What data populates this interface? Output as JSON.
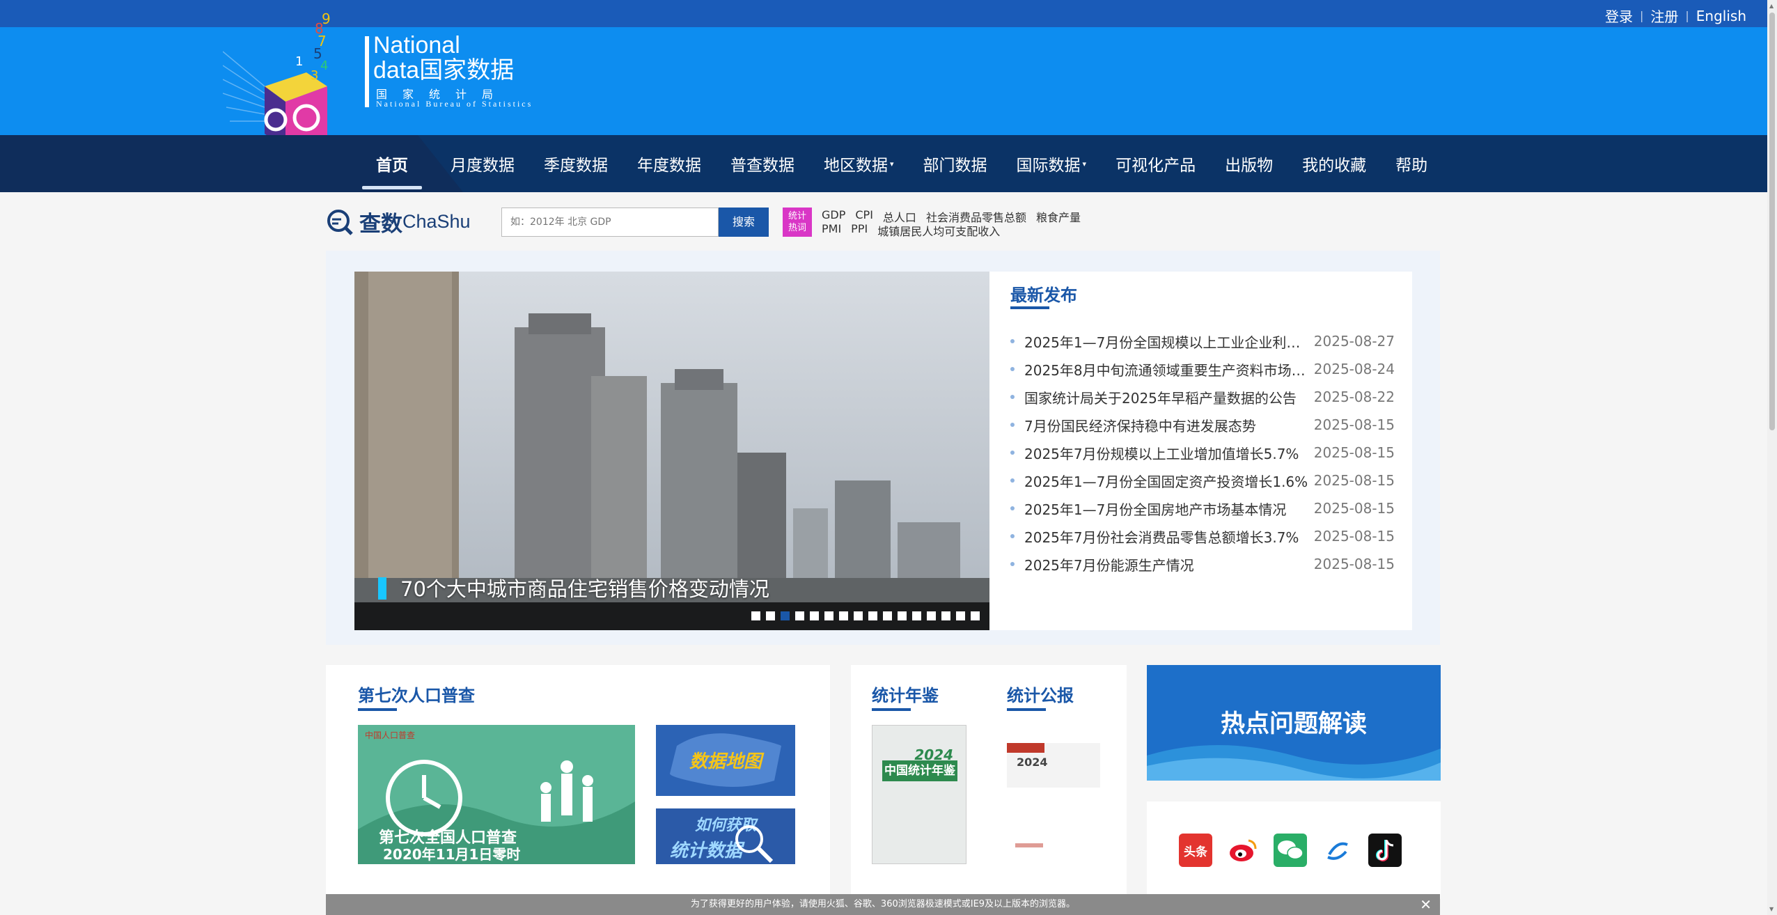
{
  "top_links": {
    "login": "登录",
    "register": "注册",
    "english": "English",
    "sep": "|"
  },
  "logo": {
    "en_line1": "National",
    "en_line2_a": "data",
    "en_line2_b": "国家数据",
    "cn_sub": "国家统计局",
    "en_sub": "National Bureau of Statistics"
  },
  "nav": {
    "items": [
      {
        "label": "首页",
        "active": true
      },
      {
        "label": "月度数据"
      },
      {
        "label": "季度数据"
      },
      {
        "label": "年度数据"
      },
      {
        "label": "普查数据"
      },
      {
        "label": "地区数据",
        "dropdown": true
      },
      {
        "label": "部门数据"
      },
      {
        "label": "国际数据",
        "dropdown": true
      },
      {
        "label": "可视化产品"
      },
      {
        "label": "出版物"
      },
      {
        "label": "我的收藏"
      },
      {
        "label": "帮助"
      }
    ]
  },
  "search": {
    "brand_cn": "查数",
    "brand_en": "ChaShu",
    "placeholder": "如：2012年 北京 GDP",
    "button": "搜索",
    "hot_badge_line1": "统计",
    "hot_badge_line2": "热词",
    "hot_row1": [
      "GDP",
      "CPI",
      "总人口",
      "社会消费品零售总额",
      "粮食产量"
    ],
    "hot_row2": [
      "PMI",
      "PPI",
      "城镇居民人均可支配收入"
    ]
  },
  "slider": {
    "caption": "70个大中城市商品住宅销售价格变动情况",
    "dot_count": 16,
    "active_dot": 2
  },
  "latest": {
    "title": "最新发布",
    "items": [
      {
        "title": "2025年1—7月份全国规模以上工业企业利润...",
        "date": "2025-08-27"
      },
      {
        "title": "2025年8月中旬流通领域重要生产资料市场价...",
        "date": "2025-08-24"
      },
      {
        "title": "国家统计局关于2025年早稻产量数据的公告",
        "date": "2025-08-22"
      },
      {
        "title": "7月份国民经济保持稳中有进发展态势",
        "date": "2025-08-15"
      },
      {
        "title": "2025年7月份规模以上工业增加值增长5.7%",
        "date": "2025-08-15"
      },
      {
        "title": "2025年1—7月份全国固定资产投资增长1.6%",
        "date": "2025-08-15"
      },
      {
        "title": "2025年1—7月份全国房地产市场基本情况",
        "date": "2025-08-15"
      },
      {
        "title": "2025年7月份社会消费品零售总额增长3.7%",
        "date": "2025-08-15"
      },
      {
        "title": "2025年7月份能源生产情况",
        "date": "2025-08-15"
      }
    ]
  },
  "census": {
    "title": "第七次人口普查",
    "img_org": "中国人口普查",
    "img_line1": "第七次全国人口普查",
    "img_line2": "2020年11月1日零时",
    "map_label": "数据地图",
    "how_label1": "如何获取",
    "how_label2": "统计数据"
  },
  "yearbook": {
    "title": "统计年鉴",
    "cover_year": "2024",
    "cover_title": "中国统计年鉴"
  },
  "bulletin": {
    "title": "统计公报",
    "img_year": "2024"
  },
  "hot_topic": {
    "label": "热点问题解读"
  },
  "social": {
    "icons": [
      "toutiao-icon",
      "weibo-icon",
      "wechat-icon",
      "app-icon",
      "douyin-icon"
    ],
    "toutiao_text": "头条"
  },
  "notice": {
    "text": "为了获得更好的用户体验，请使用火狐、谷歌、360浏览器极速模式或IE9及以上版本的浏览器。",
    "close": "✕"
  }
}
